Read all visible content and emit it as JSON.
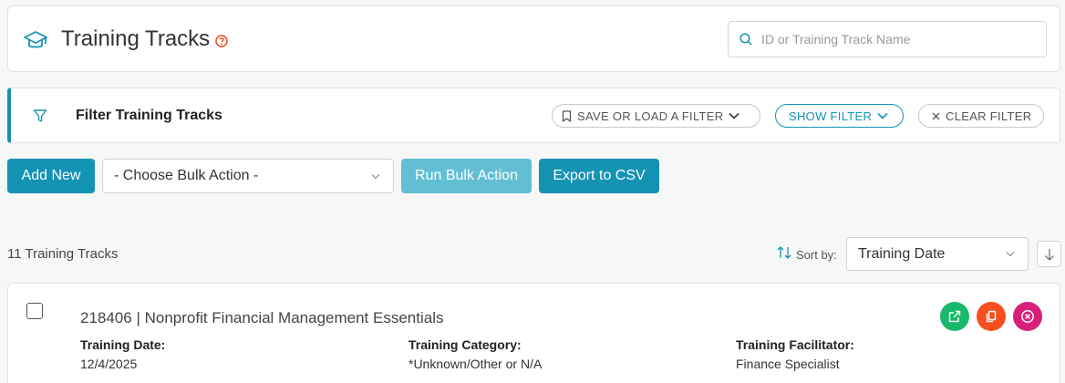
{
  "header": {
    "title": "Training Tracks",
    "icon": "graduation-cap-icon",
    "help_icon": "help-circle-icon",
    "search_placeholder": "ID or Training Track Name"
  },
  "filter": {
    "title": "Filter Training Tracks",
    "save_load_label": "SAVE OR LOAD A FILTER",
    "show_filter_label": "SHOW FILTER",
    "clear_filter_label": "CLEAR FILTER"
  },
  "toolbar": {
    "add_new_label": "Add New",
    "bulk_action_selected": "- Choose Bulk Action -",
    "run_bulk_label": "Run Bulk Action",
    "export_label": "Export to CSV"
  },
  "list": {
    "count_text": "11 Training Tracks",
    "sort_label": "Sort by:",
    "sort_selected": "Training Date",
    "rows": [
      {
        "title": "218406 | Nonprofit Financial Management Essentials",
        "fields": [
          {
            "label": "Training Date:",
            "value": "12/4/2025"
          },
          {
            "label": "Training Category:",
            "value": "*Unknown/Other or N/A"
          },
          {
            "label": "Training Facilitator:",
            "value": "Finance Specialist"
          }
        ]
      }
    ]
  },
  "colors": {
    "accent": "#1493b4",
    "accent_disabled": "#62bfd3",
    "open_green": "#17b96a",
    "copy_orange": "#f5501e",
    "delete_pink": "#d8207a",
    "help_red": "#e8491d"
  }
}
